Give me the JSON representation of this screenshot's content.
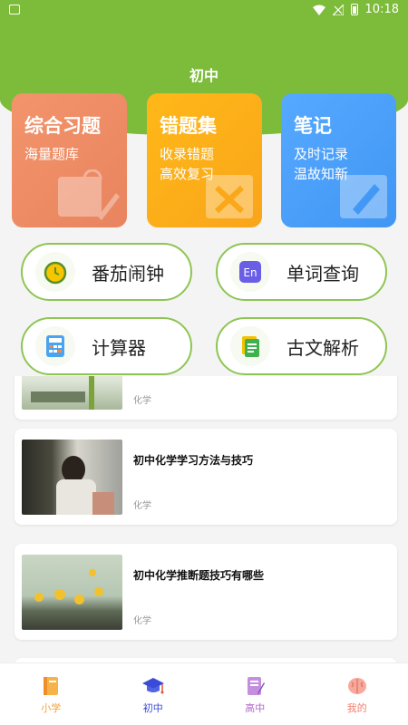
{
  "status_bar": {
    "time": "10:18"
  },
  "header": {
    "title": "初中"
  },
  "cards": [
    {
      "title": "综合习题",
      "sub1": "海量题库",
      "sub2": ""
    },
    {
      "title": "错题集",
      "sub1": "收录错题",
      "sub2": "高效复习"
    },
    {
      "title": "笔记",
      "sub1": "及时记录",
      "sub2": "温故知新"
    }
  ],
  "tools": [
    {
      "label": "番茄闹钟",
      "icon": "alarm-clock-icon"
    },
    {
      "label": "单词查询",
      "icon": "en-dictionary-icon"
    },
    {
      "label": "计算器",
      "icon": "calculator-icon"
    },
    {
      "label": "古文解析",
      "icon": "document-icon"
    }
  ],
  "articles": [
    {
      "title": "",
      "tag": "化学"
    },
    {
      "title": "初中化学学习方法与技巧",
      "tag": "化学"
    },
    {
      "title": "初中化学推断题技巧有哪些",
      "tag": "化学"
    },
    {
      "title": "",
      "tag": ""
    }
  ],
  "nav": [
    {
      "label": "小学",
      "icon": "book-icon"
    },
    {
      "label": "初中",
      "icon": "graduation-cap-icon"
    },
    {
      "label": "高中",
      "icon": "notebook-pen-icon"
    },
    {
      "label": "我的",
      "icon": "brain-icon"
    }
  ],
  "colors": {
    "header_green": "#7dbb3a",
    "card_orange": "#f08c65",
    "card_yellow": "#fdb01a",
    "card_blue": "#4d9ffa",
    "pill_border": "#8ec553",
    "nav_active": "#3a4bd8"
  }
}
